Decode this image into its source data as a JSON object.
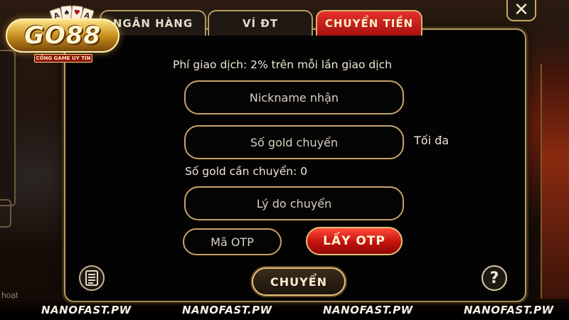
{
  "tabs": [
    {
      "label": "NGÂN HÀNG"
    },
    {
      "label": "VÍ ĐT"
    },
    {
      "label": "CHUYỂN TIỀN"
    }
  ],
  "logo": {
    "text": "GO88",
    "tagline": "CỔNG GAME UY TÍN"
  },
  "form": {
    "fee_text": "Phí giao dịch: 2% trên mỗi lần giao dịch",
    "nickname_placeholder": "Nickname nhận",
    "gold_placeholder": "Số gold chuyển",
    "max_label": "Tối đa",
    "gold_needed": "Số gold cần chuyển: 0",
    "reason_placeholder": "Lý do chuyển",
    "otp_placeholder": "Mã OTP",
    "get_otp_label": "LẤY OTP",
    "submit_label": "CHUYỂN"
  },
  "help_glyph": "?",
  "close_glyph": "✕",
  "background": {
    "side_text": "hoạt"
  },
  "watermarks": [
    "NANOFAST.PW",
    "NANOFAST.PW",
    "NANOFAST.PW",
    "NANOFAST.PW"
  ],
  "colors": {
    "gold_border": "#c5a368",
    "active_tab": "#d12620",
    "otp_red": "#c4120c"
  },
  "icons": {
    "close": "close-icon",
    "help": "help-icon",
    "history": "document-list-icon"
  }
}
